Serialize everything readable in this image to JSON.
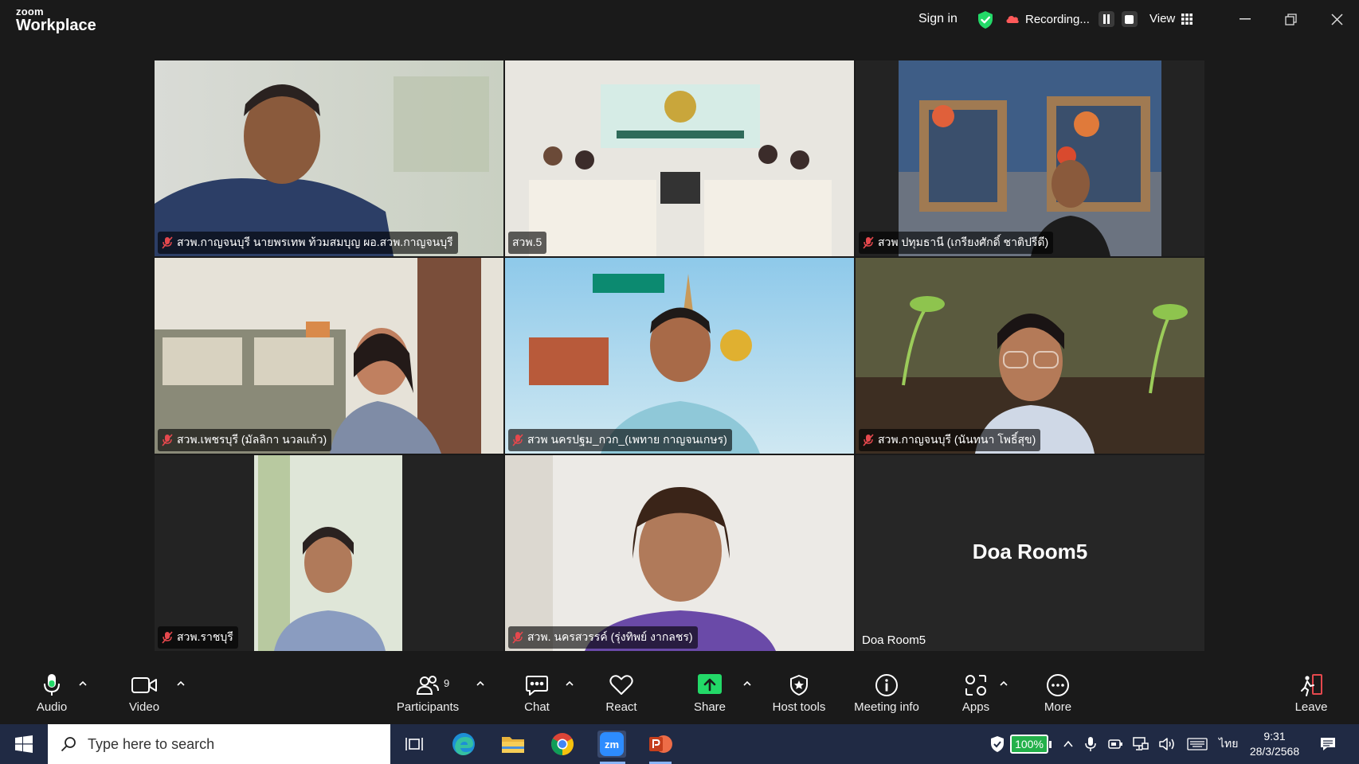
{
  "app": {
    "logo_line1": "zoom",
    "logo_line2": "Workplace"
  },
  "titlebar": {
    "sign_in": "Sign in",
    "recording": "Recording...",
    "view": "View"
  },
  "tiles": [
    {
      "name": "สวพ.กาญจนบุรี นายพรเทพ ท้วมสมบุญ ผอ.สวพ.กาญจนบุรี",
      "muted": true
    },
    {
      "name": "สวพ.5",
      "muted": false,
      "active": true
    },
    {
      "name": "สวพ ปทุมธานี (เกรียงศักดิ์ ชาติปรีดี)",
      "muted": true
    },
    {
      "name": "สวพ.เพชรบุรี (มัลลิกา นวลแก้ว)",
      "muted": true
    },
    {
      "name": "สวพ นครปฐม_กวก_(เพทาย กาญจนเกษร)",
      "muted": true
    },
    {
      "name": "สวพ.กาญจนบุรี (นันทนา โพธิ์สุข)",
      "muted": true
    },
    {
      "name": "สวพ.ราชบุรี",
      "muted": true
    },
    {
      "name": "สวพ. นครสวรรค์ (รุ่งทิพย์ งากลชร)",
      "muted": true
    },
    {
      "name": "Doa Room5",
      "title": "Doa Room5",
      "muted": false
    }
  ],
  "toolbar": {
    "audio": "Audio",
    "video": "Video",
    "participants": "Participants",
    "participants_count": "9",
    "chat": "Chat",
    "react": "React",
    "share": "Share",
    "host_tools": "Host tools",
    "meeting_info": "Meeting info",
    "apps": "Apps",
    "more": "More",
    "leave": "Leave"
  },
  "taskbar": {
    "search_placeholder": "Type here to search",
    "zoom_label": "zm",
    "battery": "100%",
    "language": "ไทย",
    "time": "9:31",
    "date": "28/3/2568"
  },
  "colors": {
    "active_speaker": "#23d968",
    "share_green": "#23d968",
    "leave_red": "#e5484d",
    "taskbar": "#202a44"
  }
}
